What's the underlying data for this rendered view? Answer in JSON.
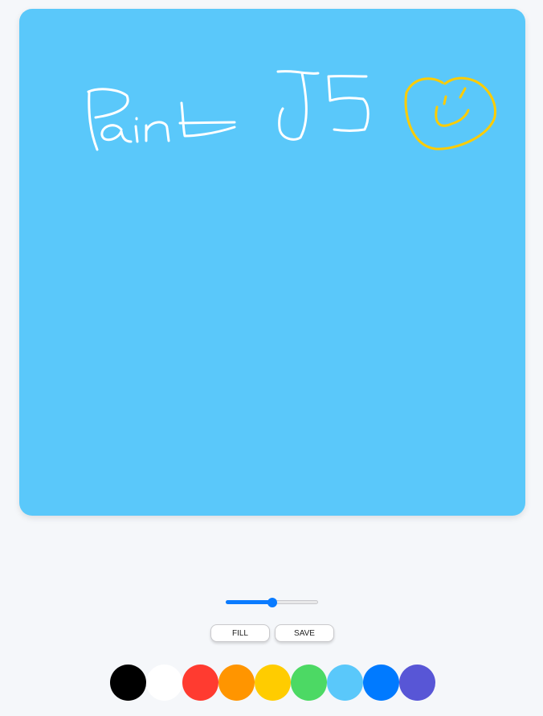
{
  "canvas": {
    "background": "#5ac8fa",
    "stroke_colors": {
      "text": "#ffffff",
      "smiley": "#ffcc00"
    }
  },
  "controls": {
    "brush_size_fraction": 0.5,
    "fill_label": "FILL",
    "save_label": "SAVE"
  },
  "palette": [
    {
      "name": "black",
      "color": "#000000"
    },
    {
      "name": "white",
      "color": "#ffffff"
    },
    {
      "name": "red",
      "color": "#ff3b30"
    },
    {
      "name": "orange",
      "color": "#ff9500"
    },
    {
      "name": "yellow",
      "color": "#ffcc00"
    },
    {
      "name": "green",
      "color": "#4cd964"
    },
    {
      "name": "light-blue",
      "color": "#5ac8fa"
    },
    {
      "name": "blue",
      "color": "#007aff"
    },
    {
      "name": "purple",
      "color": "#5856d6"
    }
  ]
}
